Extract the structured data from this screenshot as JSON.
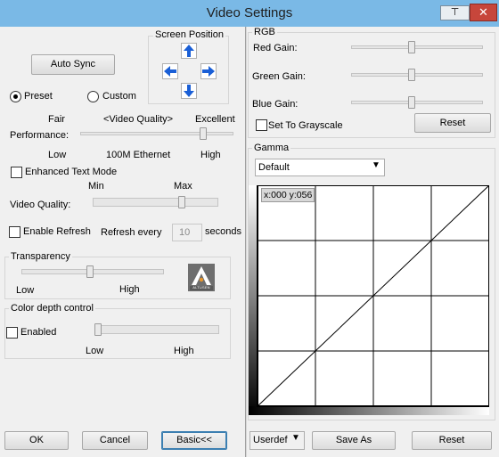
{
  "window": {
    "title": "Video Settings",
    "pin_glyph": "⊤",
    "close_glyph": "✕"
  },
  "left": {
    "position_group": {
      "label": "Screen Position"
    },
    "auto_sync_label": "Auto Sync",
    "preset_label": "Preset",
    "custom_label": "Custom",
    "performance": {
      "fair": "Fair",
      "video_quality": "<Video Quality>",
      "excellent": "Excellent",
      "label": "Performance:",
      "low": "Low",
      "ethernet": "100M Ethernet",
      "high": "High",
      "level": 0.82
    },
    "enhanced_text_label": "Enhanced Text Mode",
    "video_quality": {
      "min": "Min",
      "max": "Max",
      "label": "Video Quality:",
      "level": 0.72
    },
    "enable_refresh_label": "Enable Refresh",
    "refresh_every_label": "Refresh every",
    "refresh_value": "10",
    "seconds_label": "seconds",
    "transparency": {
      "label": "Transparency",
      "low": "Low",
      "high": "High",
      "level": 0.48
    },
    "logo_text": "ALTUSEN",
    "color_depth": {
      "label": "Color depth control",
      "enabled_label": "Enabled",
      "low": "Low",
      "high": "High",
      "level": 0.0
    },
    "ok_label": "OK",
    "cancel_label": "Cancel",
    "basic_label": "Basic<<"
  },
  "right": {
    "rgb_label": "RGB",
    "red_label": "Red Gain:",
    "green_label": "Green Gain:",
    "blue_label": "Blue Gain:",
    "red_level": 0.46,
    "green_level": 0.46,
    "blue_level": 0.46,
    "grayscale_label": "Set To Grayscale",
    "reset_label": "Reset",
    "gamma_label": "Gamma",
    "gamma_preset": "Default",
    "coord_readout": "x:000 y:056",
    "userdef_label": "Userdef",
    "save_as_label": "Save As",
    "reset2_label": "Reset"
  },
  "colors": {
    "accent": "#1a5fd6",
    "title_bar": "#7ab9e6",
    "close": "#c7463b"
  }
}
